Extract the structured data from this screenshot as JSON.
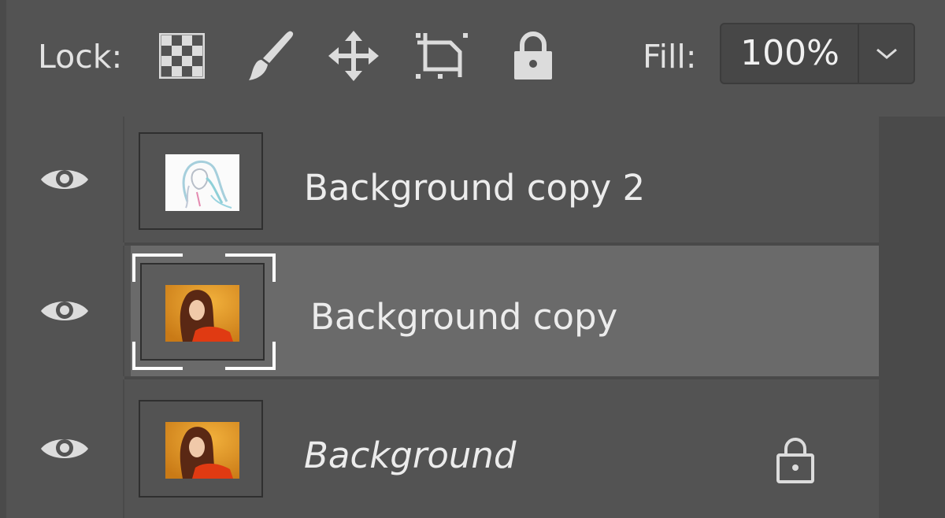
{
  "lock_bar": {
    "label": "Lock:",
    "icons": [
      {
        "name": "lock-transparent-pixels-icon"
      },
      {
        "name": "lock-image-pixels-icon"
      },
      {
        "name": "lock-position-icon"
      },
      {
        "name": "lock-artboard-icon"
      },
      {
        "name": "lock-all-icon"
      }
    ],
    "fill_label": "Fill:",
    "fill_value": "100%",
    "dropdown_icon": "chevron-down-icon"
  },
  "layers": [
    {
      "name": "Background copy 2",
      "visible": true,
      "selected": false,
      "locked": false,
      "italic": false,
      "thumbnail": "sketch"
    },
    {
      "name": "Background copy",
      "visible": true,
      "selected": true,
      "locked": false,
      "italic": false,
      "thumbnail": "photo"
    },
    {
      "name": "Background",
      "visible": true,
      "selected": false,
      "locked": true,
      "italic": true,
      "thumbnail": "photo"
    }
  ],
  "colors": {
    "panel_bg": "#535353",
    "selected_row_bg": "#6a6a6a",
    "text": "#ececec",
    "icon": "#dcdcdc",
    "photo_bg": "#e59a2a",
    "photo_shirt": "#e03a12"
  }
}
